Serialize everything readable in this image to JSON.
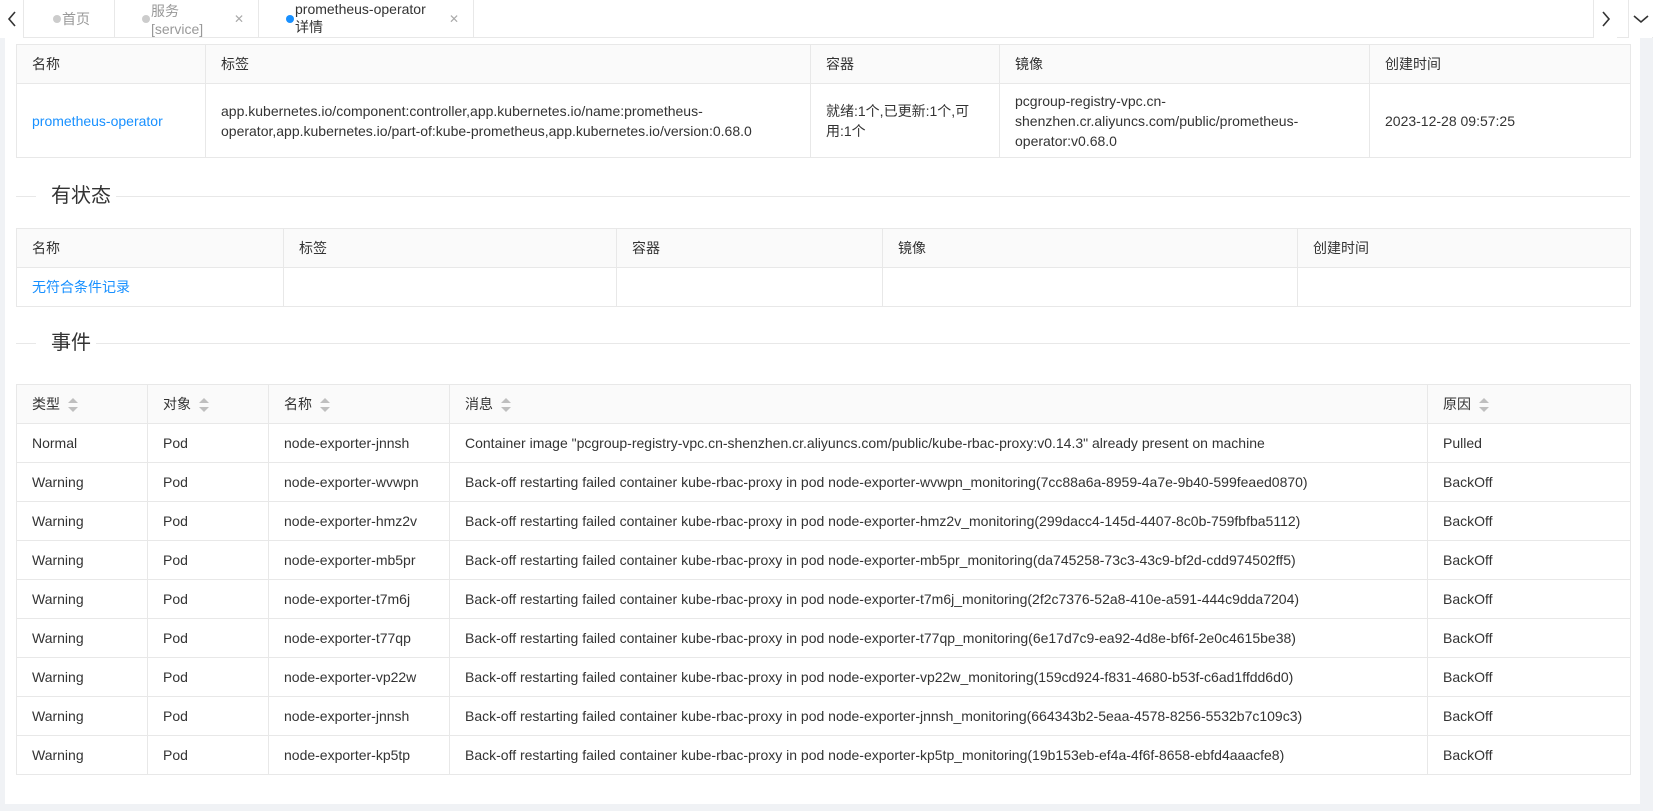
{
  "tabs": [
    {
      "label": "首页",
      "active": false,
      "closable": false
    },
    {
      "label": "服务[service]",
      "active": false,
      "closable": true
    },
    {
      "label": "prometheus-operator详情",
      "active": true,
      "closable": true
    }
  ],
  "deployments": {
    "headers": [
      "名称",
      "标签",
      "容器",
      "镜像",
      "创建时间"
    ],
    "row": {
      "name": "prometheus-operator",
      "labels_line1": "app.kubernetes.io/component:controller,app.kubernetes.io/name:prometheus-",
      "labels_line2": "operator,app.kubernetes.io/part-of:kube-prometheus,app.kubernetes.io/version:0.68.0",
      "containers_line1": "就绪:1个,已更新:1个,可",
      "containers_line2": "用:1个",
      "image_line1": "pcgroup-registry-vpc.cn-",
      "image_line2": "shenzhen.cr.aliyuncs.com/public/prometheus-",
      "image_line3": "operator:v0.68.0",
      "created": "2023-12-28 09:57:25"
    }
  },
  "stateful": {
    "title": "有状态",
    "headers": [
      "名称",
      "标签",
      "容器",
      "镜像",
      "创建时间"
    ],
    "empty_text": "无符合条件记录"
  },
  "events": {
    "title": "事件",
    "headers": [
      "类型",
      "对象",
      "名称",
      "消息",
      "原因"
    ],
    "rows": [
      {
        "type": "Normal",
        "object": "Pod",
        "name": "node-exporter-jnnsh",
        "message": "Container image \"pcgroup-registry-vpc.cn-shenzhen.cr.aliyuncs.com/public/kube-rbac-proxy:v0.14.3\" already present on machine",
        "reason": "Pulled"
      },
      {
        "type": "Warning",
        "object": "Pod",
        "name": "node-exporter-wvwpn",
        "message": "Back-off restarting failed container kube-rbac-proxy in pod node-exporter-wvwpn_monitoring(7cc88a6a-8959-4a7e-9b40-599feaed0870)",
        "reason": "BackOff"
      },
      {
        "type": "Warning",
        "object": "Pod",
        "name": "node-exporter-hmz2v",
        "message": "Back-off restarting failed container kube-rbac-proxy in pod node-exporter-hmz2v_monitoring(299dacc4-145d-4407-8c0b-759fbfba5112)",
        "reason": "BackOff"
      },
      {
        "type": "Warning",
        "object": "Pod",
        "name": "node-exporter-mb5pr",
        "message": "Back-off restarting failed container kube-rbac-proxy in pod node-exporter-mb5pr_monitoring(da745258-73c3-43c9-bf2d-cdd974502ff5)",
        "reason": "BackOff"
      },
      {
        "type": "Warning",
        "object": "Pod",
        "name": "node-exporter-t7m6j",
        "message": "Back-off restarting failed container kube-rbac-proxy in pod node-exporter-t7m6j_monitoring(2f2c7376-52a8-410e-a591-444c9dda7204)",
        "reason": "BackOff"
      },
      {
        "type": "Warning",
        "object": "Pod",
        "name": "node-exporter-t77qp",
        "message": "Back-off restarting failed container kube-rbac-proxy in pod node-exporter-t77qp_monitoring(6e17d7c9-ea92-4d8e-bf6f-2e0c4615be38)",
        "reason": "BackOff"
      },
      {
        "type": "Warning",
        "object": "Pod",
        "name": "node-exporter-vp22w",
        "message": "Back-off restarting failed container kube-rbac-proxy in pod node-exporter-vp22w_monitoring(159cd924-f831-4680-b53f-c6ad1ffdd6d0)",
        "reason": "BackOff"
      },
      {
        "type": "Warning",
        "object": "Pod",
        "name": "node-exporter-jnnsh",
        "message": "Back-off restarting failed container kube-rbac-proxy in pod node-exporter-jnnsh_monitoring(664343b2-5eaa-4578-8256-5532b7c109c3)",
        "reason": "BackOff"
      },
      {
        "type": "Warning",
        "object": "Pod",
        "name": "node-exporter-kp5tp",
        "message": "Back-off restarting failed container kube-rbac-proxy in pod node-exporter-kp5tp_monitoring(19b153eb-ef4a-4f6f-8658-ebfd4aaacfe8)",
        "reason": "BackOff"
      }
    ]
  },
  "colors": {
    "accent": "#1890ff",
    "border": "#e8e8e8",
    "header_bg": "#fafafa"
  }
}
